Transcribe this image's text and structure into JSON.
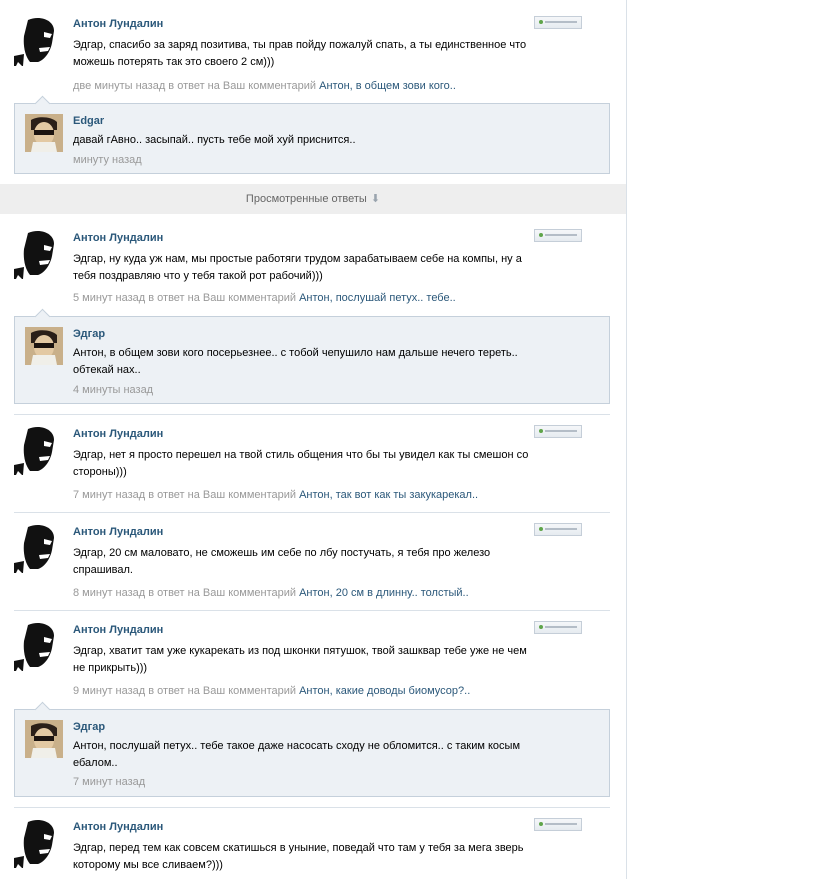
{
  "viewed_answers": {
    "label": "Просмотренные ответы",
    "arrow": "⬇"
  },
  "colors": {
    "link": "#2b587a",
    "meta": "#999999",
    "reply_bg": "#edf1f5",
    "bar_bg": "#eeeeee"
  },
  "items": [
    {
      "author": "Антон Лундалин",
      "text": "Эдгар, спасибо за заряд позитива, ты прав пойду пожалуй спать, а ты единственное что можешь потерять так это своего 2 см)))",
      "time": "две минуты назад в ответ на Ваш комментарий",
      "reply_link": "Антон, в общем зови кого.."
    },
    {
      "author": "Edgar",
      "text": "давай гАвно.. засыпай.. пусть тебе мой хуй приснится..",
      "time": "минуту назад"
    },
    {
      "author": "Антон Лундалин",
      "text": "Эдгар, ну куда уж нам, мы простые работяги трудом зарабатываем себе на компы, ну а тебя поздравляю что у тебя такой рот рабочий)))",
      "time": "5 минут назад в ответ на Ваш комментарий",
      "reply_link": "Антон, послушай петух.. тебе.."
    },
    {
      "author": "Эдгар",
      "text": "Антон, в общем зови кого посерьезнее.. с тобой чепушило нам дальше нечего тереть.. обтекай нах..",
      "time": "4 минуты назад"
    },
    {
      "author": "Антон Лундалин",
      "text": "Эдгар, нет я просто перешел на твой стиль общения что бы ты увидел как ты смешон со стороны)))",
      "time": "7 минут назад в ответ на Ваш комментарий",
      "reply_link": "Антон, так вот как ты закукарекал.."
    },
    {
      "author": "Антон Лундалин",
      "text": "Эдгар, 20 см маловато, не сможешь им себе по лбу постучать, я тебя про железо спрашивал.",
      "time": "8 минут назад в ответ на Ваш комментарий",
      "reply_link": "Антон, 20 см в длинну.. толстый.."
    },
    {
      "author": "Антон Лундалин",
      "text": "Эдгар, хватит там уже кукарекать из под шконки пятушок, твой зашквар тебе уже не чем не прикрыть)))",
      "time": "9 минут назад в ответ на Ваш комментарий",
      "reply_link": "Антон, какие доводы биомусор?.."
    },
    {
      "author": "Эдгар",
      "text": "Антон, послушай петух.. тебе такое даже насосать сходу не обломится.. с таким косым ебалом..",
      "time": "7 минут назад"
    },
    {
      "author": "Антон Лундалин",
      "text": "Эдгар, перед тем как совсем скатишься в уныние, поведай что там у тебя за мега зверь которому мы все сливаем?)))"
    }
  ]
}
